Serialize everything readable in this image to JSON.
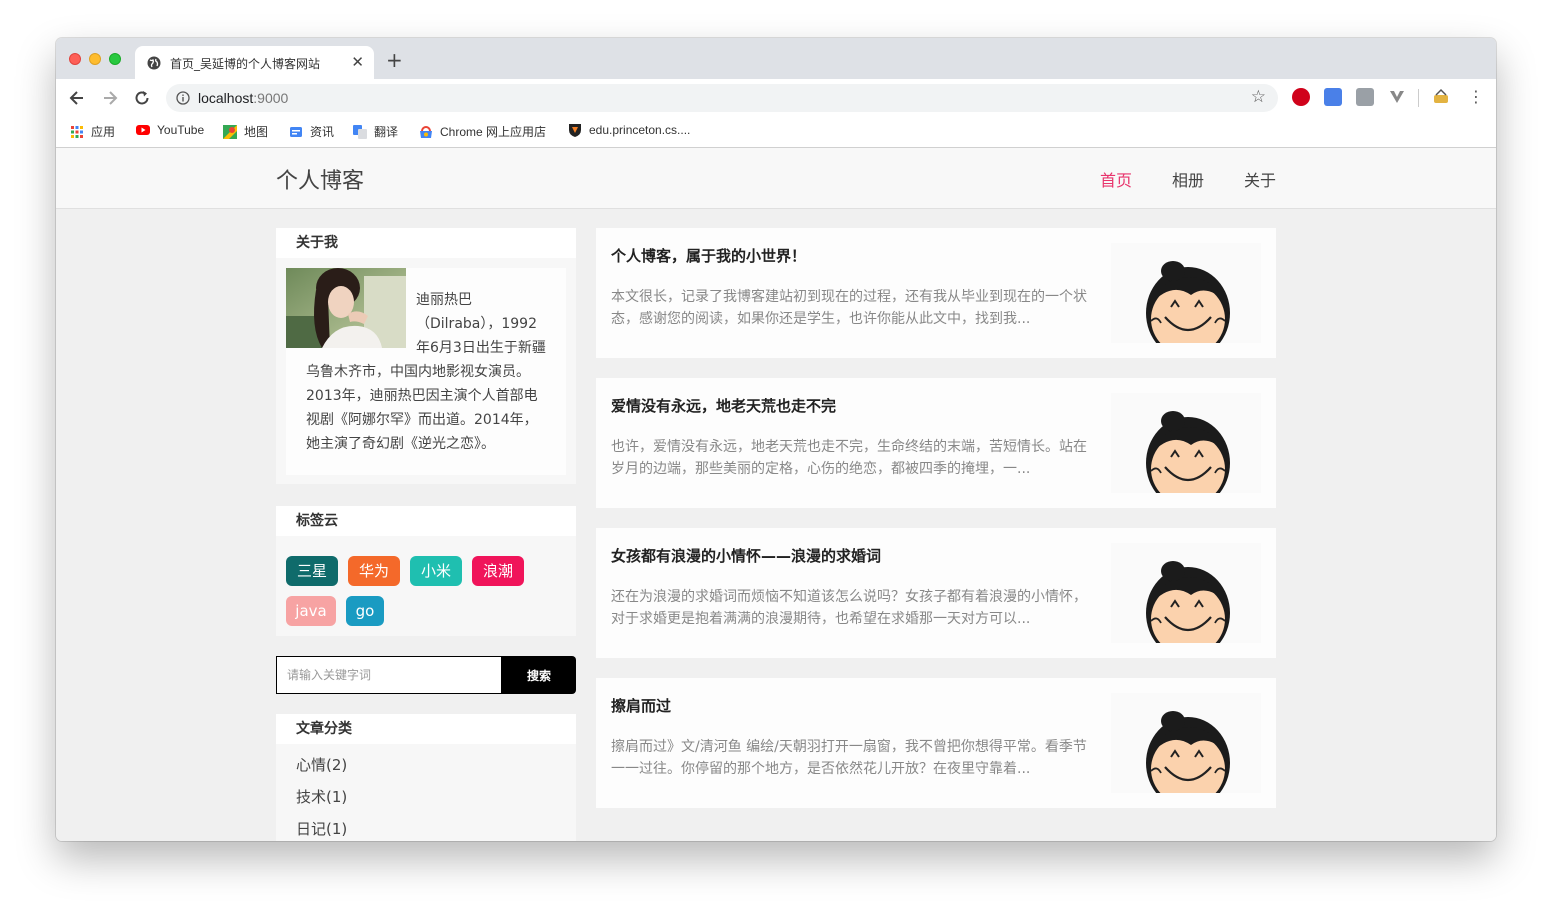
{
  "browser": {
    "tab_title": "首页_吴延博的个人博客网站",
    "tab_close": "✕",
    "new_tab": "+",
    "url_host": "localhost",
    "url_port": ":9000",
    "bookmarks": [
      {
        "label": "应用",
        "icon": "apps-icon"
      },
      {
        "label": "YouTube",
        "icon": "youtube-icon"
      },
      {
        "label": "地图",
        "icon": "maps-icon"
      },
      {
        "label": "资讯",
        "icon": "news-icon"
      },
      {
        "label": "翻译",
        "icon": "translate-icon"
      },
      {
        "label": "Chrome 网上应用店",
        "icon": "webstore-icon"
      },
      {
        "label": "edu.princeton.cs....",
        "icon": "princeton-icon"
      }
    ]
  },
  "site": {
    "logo": "个人博客",
    "nav": [
      {
        "label": "首页",
        "active": true
      },
      {
        "label": "相册",
        "active": false
      },
      {
        "label": "关于",
        "active": false
      }
    ],
    "accent_color": "#e8346c"
  },
  "sidebar": {
    "about_title": "关于我",
    "about_text": "迪丽热巴（Dilraba），1992年6月3日出生于新疆乌鲁木齐市，中国内地影视女演员。2013年，迪丽热巴因主演个人首部电视剧《阿娜尔罕》而出道。2014年，她主演了奇幻剧《逆光之恋》。",
    "tags_title": "标签云",
    "tags": [
      {
        "label": "三星",
        "color": "#0f6b6b"
      },
      {
        "label": "华为",
        "color": "#f4692a"
      },
      {
        "label": "小米",
        "color": "#1fbfb0"
      },
      {
        "label": "浪潮",
        "color": "#f0145a"
      },
      {
        "label": "java",
        "color": "#f7a3a3"
      },
      {
        "label": "go",
        "color": "#1a9bc2"
      }
    ],
    "search_placeholder": "请输入关键字词",
    "search_button": "搜索",
    "categories_title": "文章分类",
    "categories": [
      "心情(2)",
      "技术(1)",
      "日记(1)"
    ]
  },
  "articles": [
    {
      "title": "个人博客，属于我的小世界！",
      "excerpt": "本文很长，记录了我博客建站初到现在的过程，还有我从毕业到现在的一个状态，感谢您的阅读，如果你还是学生，也许你能从此文中，找到我..."
    },
    {
      "title": "爱情没有永远，地老天荒也走不完",
      "excerpt": "也许，爱情没有永远，地老天荒也走不完，生命终结的末端，苦短情长。站在岁月的边端，那些美丽的定格，心伤的绝恋，都被四季的掩埋，一..."
    },
    {
      "title": "女孩都有浪漫的小情怀——浪漫的求婚词",
      "excerpt": "还在为浪漫的求婚词而烦恼不知道该怎么说吗？女孩子都有着浪漫的小情怀，对于求婚更是抱着满满的浪漫期待，也希望在求婚那一天对方可以..."
    },
    {
      "title": "擦肩而过",
      "excerpt": "擦肩而过》文/清河鱼 编绘/天朝羽打开一扇窗，我不曾把你想得平常。看季节一一过往。你停留的那个地方，是否依然花儿开放？在夜里守靠着..."
    }
  ]
}
